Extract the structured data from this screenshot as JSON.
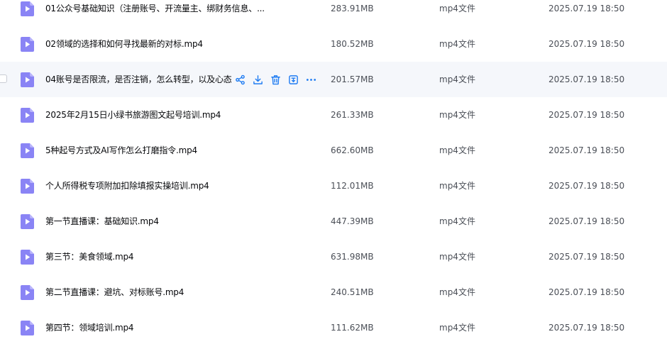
{
  "colors": {
    "icon_primary": "#8a84f5",
    "icon_fold": "#b8b3fb",
    "action_blue": "#1f7cf2",
    "hover_bg": "#f5f7fb"
  },
  "row_actions": [
    {
      "name": "share",
      "icon": "share-icon"
    },
    {
      "name": "download",
      "icon": "download-icon"
    },
    {
      "name": "delete",
      "icon": "trash-icon"
    },
    {
      "name": "open",
      "icon": "open-icon"
    },
    {
      "name": "more",
      "icon": "more-icon"
    }
  ],
  "files": [
    {
      "name": "01公众号基础知识（注册账号、开流量主、绑财务信息、...",
      "size": "283.91MB",
      "type": "mp4文件",
      "date": "2025.07.19 18:50",
      "icon": "video-file-icon"
    },
    {
      "name": "02领域的选择和如何寻找最新的对标.mp4",
      "size": "180.52MB",
      "type": "mp4文件",
      "date": "2025.07.19 18:50",
      "icon": "video-file-icon"
    },
    {
      "name": "04账号是否限流，是否注销，怎么转型，以及心态",
      "size": "201.57MB",
      "type": "mp4文件",
      "date": "2025.07.19 18:50",
      "icon": "video-file-icon",
      "hovered": true
    },
    {
      "name": "2025年2月15日小绿书旅游图文起号培训.mp4",
      "size": "261.33MB",
      "type": "mp4文件",
      "date": "2025.07.19 18:50",
      "icon": "video-file-icon"
    },
    {
      "name": "5种起号方式及AI写作怎么打磨指令.mp4",
      "size": "662.60MB",
      "type": "mp4文件",
      "date": "2025.07.19 18:50",
      "icon": "video-file-icon"
    },
    {
      "name": "个人所得税专项附加扣除填报实操培训.mp4",
      "size": "112.01MB",
      "type": "mp4文件",
      "date": "2025.07.19 18:50",
      "icon": "video-file-icon"
    },
    {
      "name": "第一节直播课：基础知识.mp4",
      "size": "447.39MB",
      "type": "mp4文件",
      "date": "2025.07.19 18:50",
      "icon": "video-file-icon"
    },
    {
      "name": "第三节：美食领域.mp4",
      "size": "631.98MB",
      "type": "mp4文件",
      "date": "2025.07.19 18:50",
      "icon": "video-file-icon"
    },
    {
      "name": "第二节直播课：避坑、对标账号.mp4",
      "size": "240.51MB",
      "type": "mp4文件",
      "date": "2025.07.19 18:50",
      "icon": "video-file-icon"
    },
    {
      "name": "第四节：领域培训.mp4",
      "size": "111.62MB",
      "type": "mp4文件",
      "date": "2025.07.19 18:50",
      "icon": "video-file-icon"
    }
  ]
}
